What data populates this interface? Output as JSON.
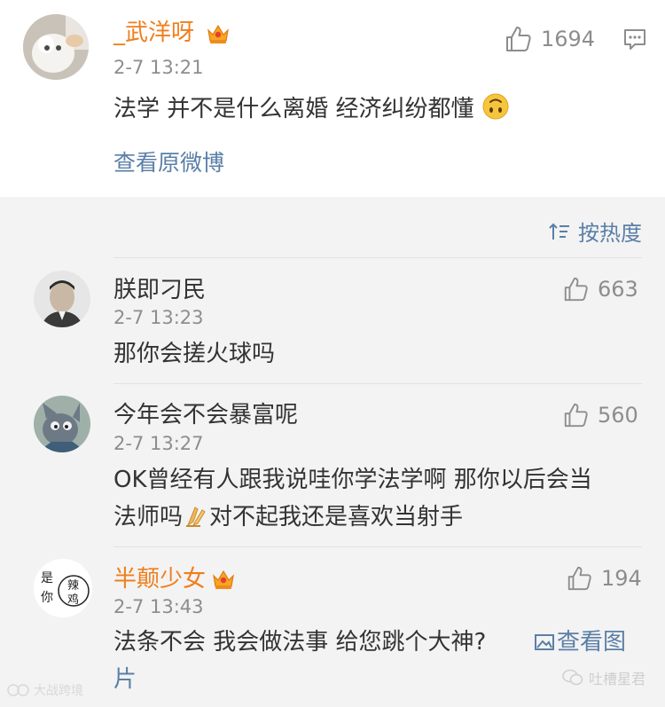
{
  "main_post": {
    "username": "_武洋呀",
    "likes": "1694",
    "time": "2-7 13:21",
    "text": "法学 并不是什么离婚 经济纠纷都懂",
    "view_original": "查看原微博"
  },
  "sort": {
    "label": "按热度"
  },
  "comments": [
    {
      "username": "朕即刁民",
      "likes": "663",
      "time": "2-7 13:23",
      "lines": [
        "那你会搓火球吗"
      ]
    },
    {
      "username": "今年会不会暴富呢",
      "likes": "560",
      "time": "2-7 13:27",
      "lines": [
        "OK曾经有人跟我说哇你学法学啊 那你以后会当",
        "法师吗",
        "对不起我还是喜欢当射手"
      ]
    },
    {
      "username": "半颠少女",
      "likes": "194",
      "time": "2-7 13:43",
      "lines": [
        "法条不会 我会做法事 给您跳个大神?",
        "查看图",
        "片"
      ]
    }
  ],
  "avatar4_text": {
    "line1": "是",
    "line2": "你",
    "line3": "辣",
    "line4": "鸡"
  },
  "watermarks": {
    "left": "大战跨境",
    "right": "吐槽星君"
  },
  "colors": {
    "vip_name": "#f07e1c",
    "link": "#5b7fa7",
    "meta": "#8d8d8d",
    "background": "#f3f3f3"
  }
}
